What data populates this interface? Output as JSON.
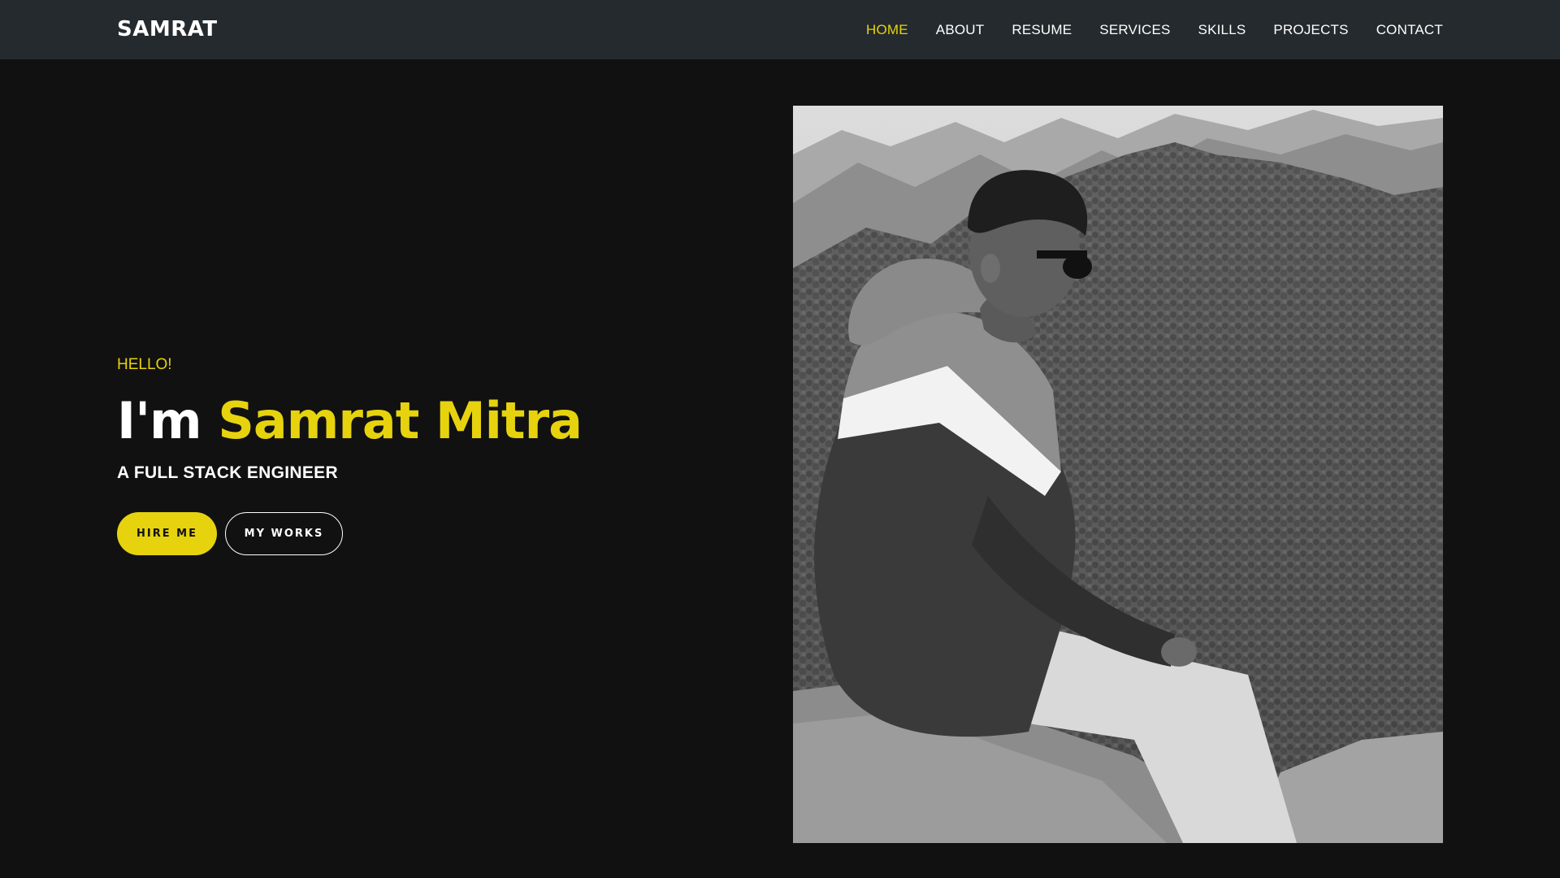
{
  "brand": "SAMRAT",
  "nav": {
    "items": [
      {
        "label": "HOME",
        "active": true
      },
      {
        "label": "ABOUT",
        "active": false
      },
      {
        "label": "RESUME",
        "active": false
      },
      {
        "label": "SERVICES",
        "active": false
      },
      {
        "label": "SKILLS",
        "active": false
      },
      {
        "label": "PROJECTS",
        "active": false
      },
      {
        "label": "CONTACT",
        "active": false
      }
    ]
  },
  "hero": {
    "greeting": "HELLO!",
    "headline_prefix": "I'm",
    "name": "Samrat Mitra",
    "subtitle": "A FULL STACK ENGINEER",
    "buttons": {
      "primary": "HIRE ME",
      "secondary": "MY WORKS"
    }
  },
  "colors": {
    "accent": "#e6d30e",
    "background": "#111112",
    "navbar": "#242a2e",
    "text": "#ffffff"
  }
}
